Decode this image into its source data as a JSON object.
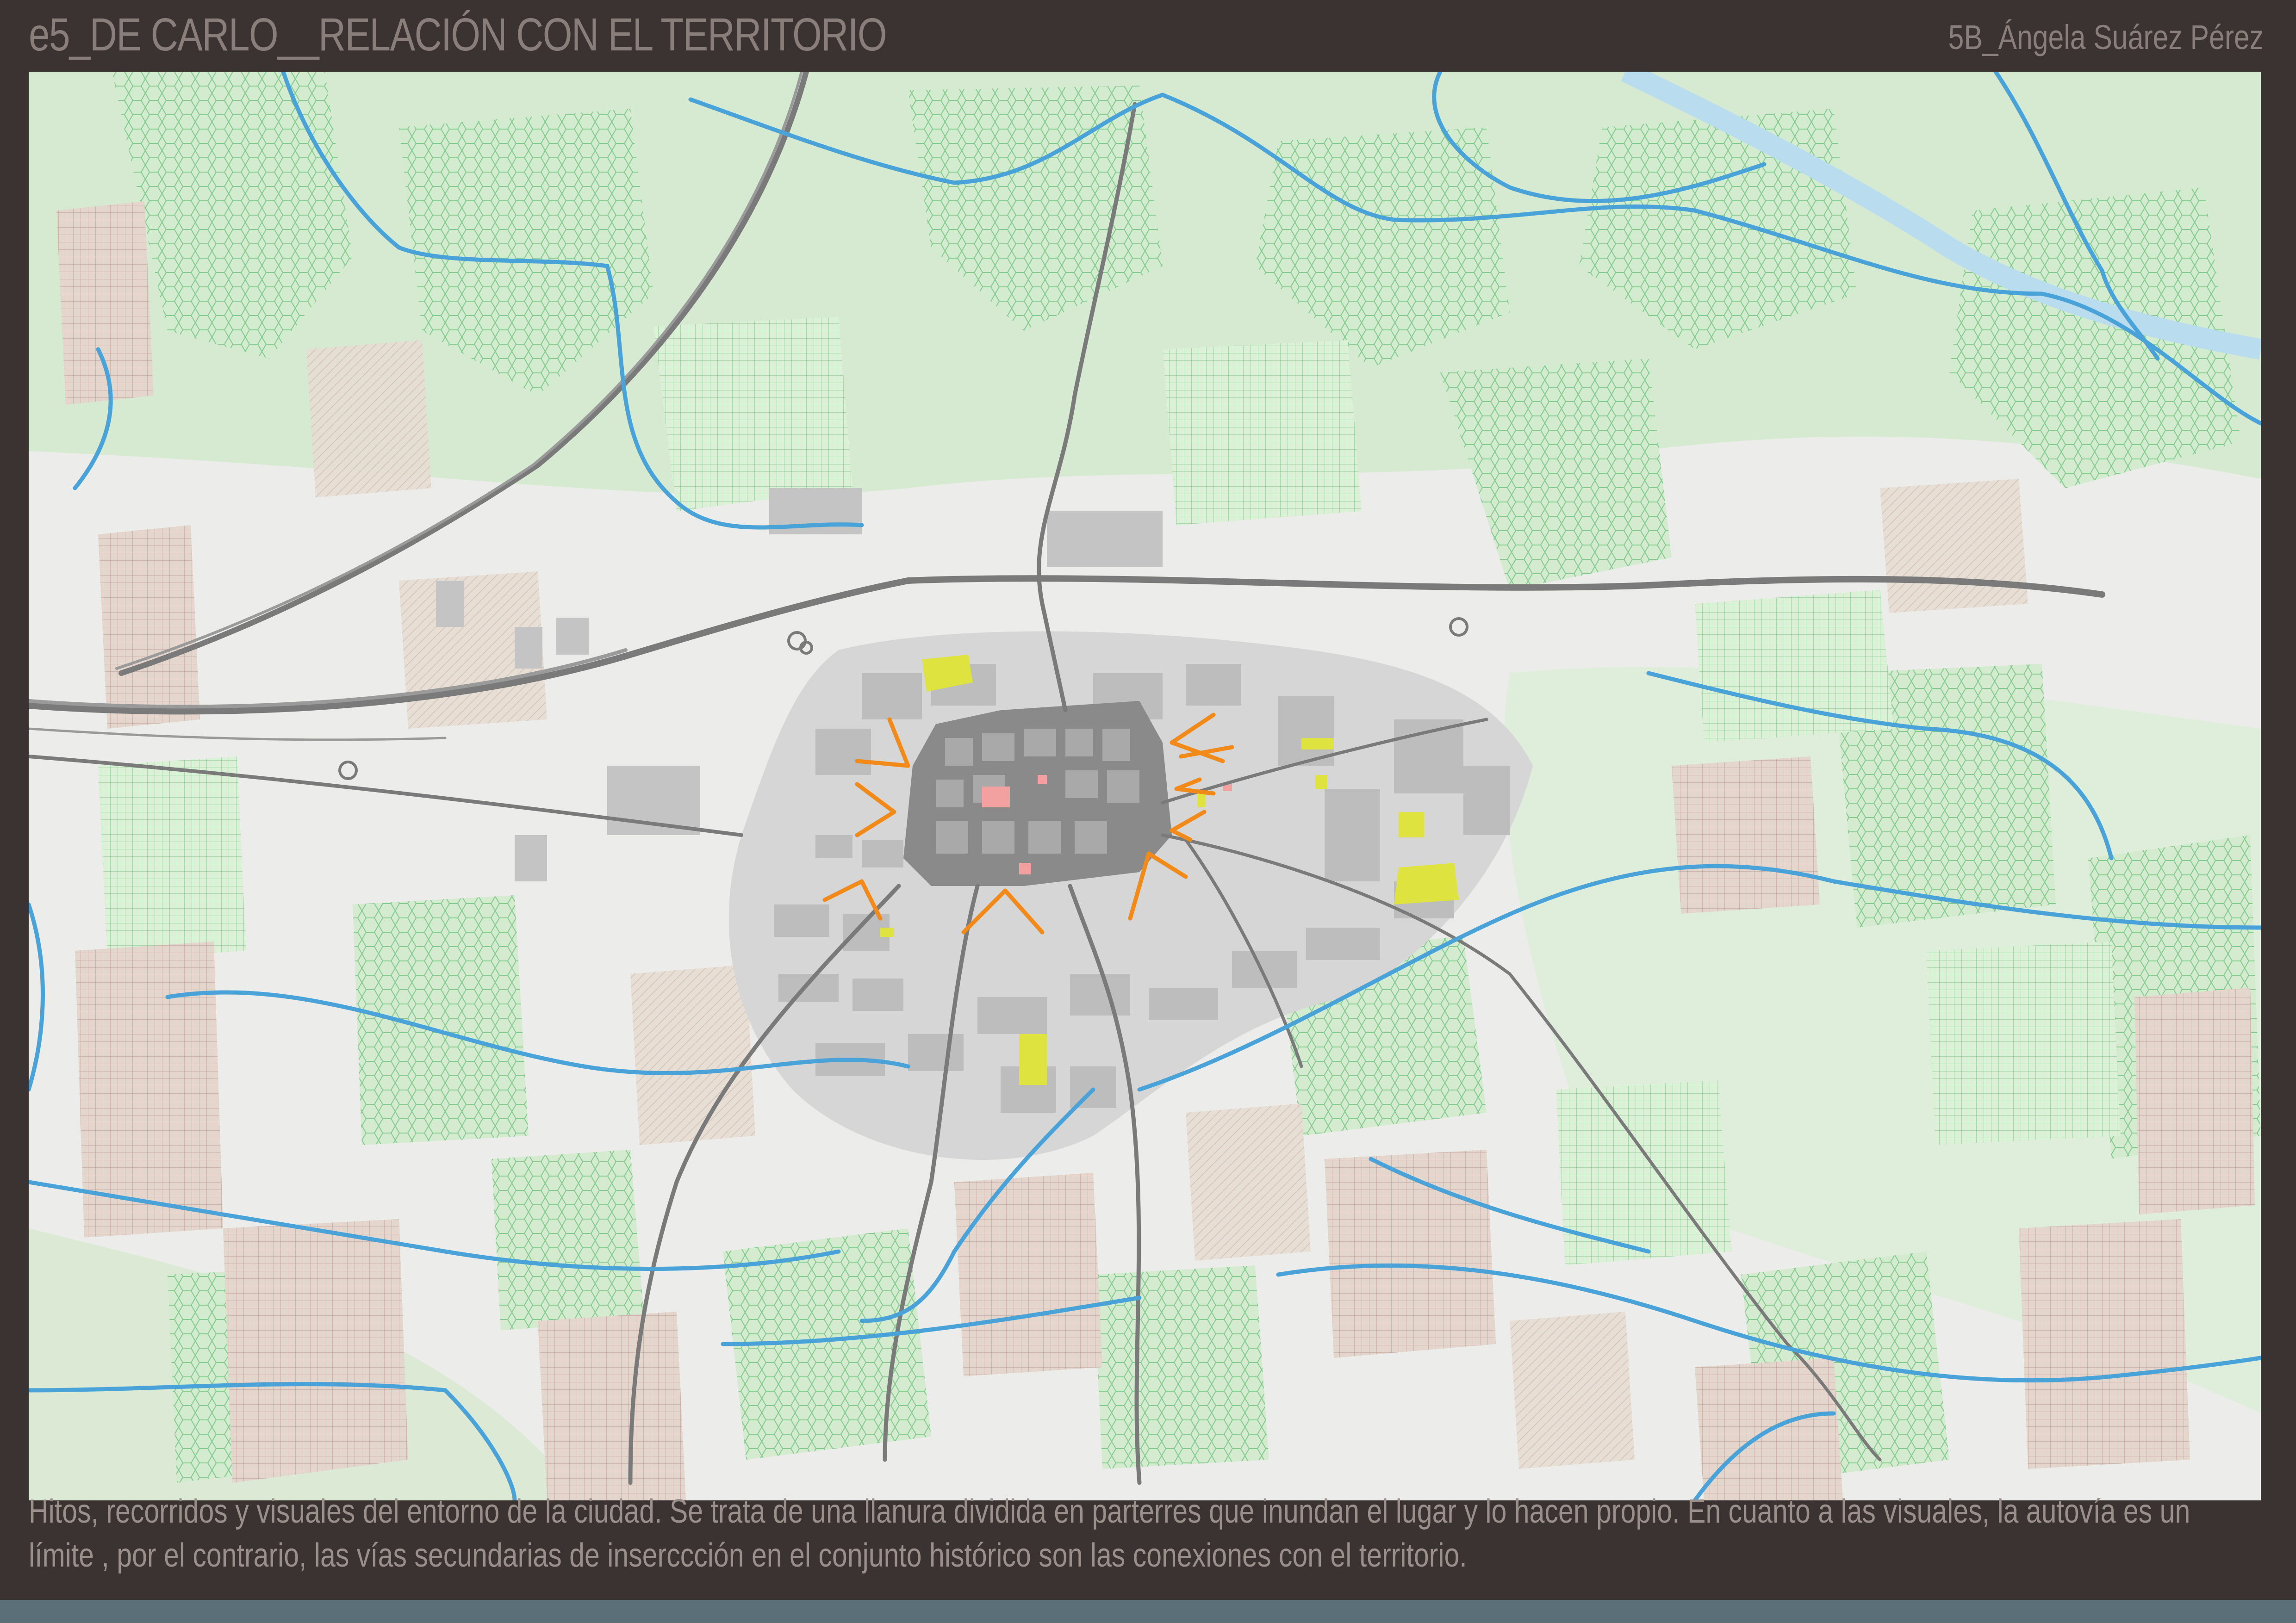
{
  "header": {
    "title": "e5_DE CARLO__RELACIÓN CON EL TERRITORIO",
    "author": "5B_Ángela Suárez Pérez"
  },
  "map": {
    "colors": {
      "background": "#ececea",
      "fields_green": "#cfe8c9",
      "fields_brown": "#d9c9bd",
      "urban": "#c8c8c8",
      "historic_center": "#8a8a8a",
      "roads": "#7a7a7a",
      "rivers": "#4aa3d8",
      "landmarks_yellow": "#dfe33f",
      "landmarks_pink": "#f2a0a0",
      "views_orange": "#f28a1a"
    }
  },
  "caption": {
    "text": "Hitos, recorridos y visuales del entorno de la ciudad. Se trata de una llanura dividida en parterres que inundan el lugar y lo hacen propio. En cuanto a las visuales, la autovía es un límite , por el contrario, las vías secundarias de inserccción en el conjunto histórico son las conexiones con el territorio."
  }
}
